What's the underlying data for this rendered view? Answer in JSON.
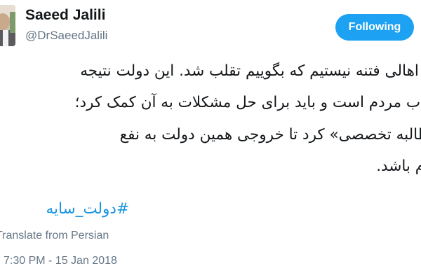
{
  "author": {
    "display_name": "Saeed Jalili",
    "handle": "@DrSaeedJalili"
  },
  "follow_button": {
    "label": "Following"
  },
  "tweet": {
    "lines": [
      "مثل اهالی فتنه نیستیم که بگوییم تقلب شد. این دولت نتیجه",
      "انتخاب مردم است و باید برای حل مشکلات به آن کمک کرد؛",
      "«مطالبه تخصصی» کرد تا خروجی همین دولت به نفع",
      "مردم باشد."
    ],
    "hashtag": "#دولت_سایه"
  },
  "translate_link": "Translate from Persian",
  "timestamp": "7:30 PM - 15 Jan 2018",
  "colors": {
    "accent": "#1da1f2",
    "link": "#1b95e0",
    "text": "#14171a",
    "secondary": "#657786"
  }
}
